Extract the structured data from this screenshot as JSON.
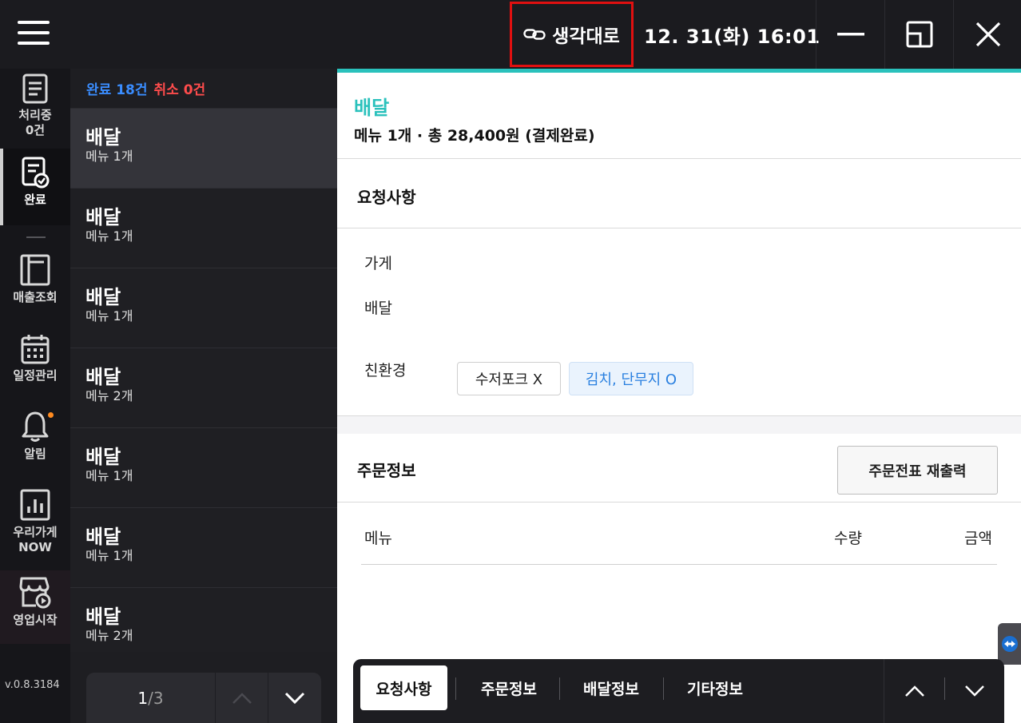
{
  "topbar": {
    "brand_label": "생각대로",
    "datetime": "12. 31(화) 16:01",
    "icons": [
      "hamburger-icon",
      "link-icon",
      "minimize-icon",
      "restore-icon",
      "close-icon"
    ]
  },
  "nav": {
    "processing_label": "처리중",
    "processing_count": "0건",
    "done_label": "완료",
    "sales_label": "매출조회",
    "schedule_label": "일정관리",
    "alerts_label": "알림",
    "store_now_line1": "우리가게",
    "store_now_line2": "NOW",
    "start_business_label": "영업시작",
    "version": "v.0.8.3184"
  },
  "list": {
    "done_count_text": "완료 18건",
    "cancel_count_text": "취소 0건",
    "orders": [
      {
        "type": "배달",
        "count": "메뉴 1개"
      },
      {
        "type": "배달",
        "count": "메뉴 1개"
      },
      {
        "type": "배달",
        "count": "메뉴 1개"
      },
      {
        "type": "배달",
        "count": "메뉴 2개"
      },
      {
        "type": "배달",
        "count": "메뉴 1개"
      },
      {
        "type": "배달",
        "count": "메뉴 1개"
      },
      {
        "type": "배달",
        "count": "메뉴 2개"
      }
    ],
    "pager": {
      "current": "1",
      "total": "/3"
    }
  },
  "detail": {
    "title": "배달",
    "summary": "메뉴 1개 · 총 28,400원 (결제완료)",
    "requests_title": "요청사항",
    "store_label": "가게",
    "delivery_label": "배달",
    "eco_label": "친환경",
    "eco_chip_cutlery": "수저포크 X",
    "eco_chip_sides": "김치, 단무지 O",
    "order_info_title": "주문정보",
    "reprint_button": "주문전표 재출력",
    "col_menu": "메뉴",
    "col_qty": "수량",
    "col_amount": "금액"
  },
  "tabs": {
    "requests": "요청사항",
    "order_info": "주문정보",
    "delivery_info": "배달정보",
    "other_info": "기타정보"
  },
  "colors": {
    "accent_teal": "#2ac1bc",
    "done_blue": "#3a8dff",
    "cancel_red": "#ff4c4c",
    "highlight_red": "#e01010"
  }
}
